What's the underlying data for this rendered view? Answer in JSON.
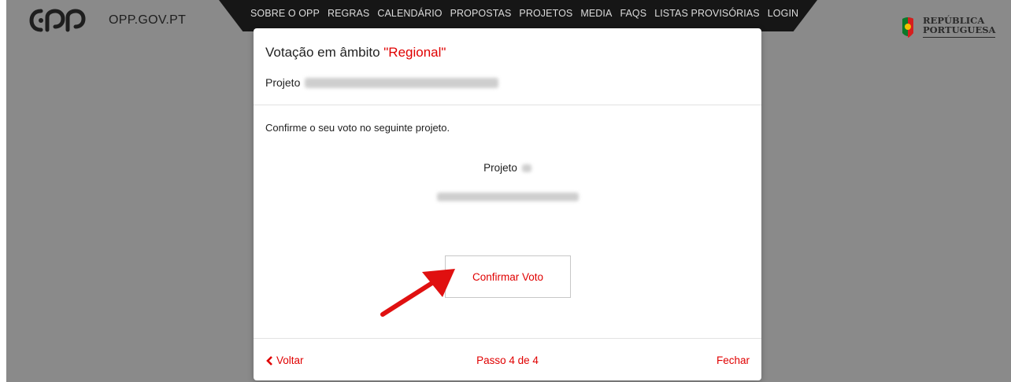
{
  "site": {
    "logo_text": "OPP.GOV.PT",
    "gov_line1": "REPÚBLICA",
    "gov_line2": "PORTUGUESA"
  },
  "nav": [
    "SOBRE O OPP",
    "REGRAS",
    "CALENDÁRIO",
    "PROPOSTAS",
    "PROJETOS",
    "MEDIA",
    "FAQS",
    "LISTAS PROVISÓRIAS",
    "LOGIN"
  ],
  "modal": {
    "title_prefix": "Votação em âmbito ",
    "title_accent": "\"Regional\"",
    "subtitle_label": "Projeto",
    "instruction": "Confirme o seu voto no seguinte projeto.",
    "project_label": "Projeto",
    "confirm_label": "Confirmar Voto",
    "footer": {
      "back_label": "Voltar",
      "step_label": "Passo 4 de 4",
      "close_label": "Fechar"
    }
  },
  "colors": {
    "accent": "#e00000",
    "backdrop": "#8a8a8a",
    "nav_bg": "#161616"
  },
  "icons": {
    "back": "chevron-left-icon",
    "annotation": "red-arrow-icon"
  }
}
